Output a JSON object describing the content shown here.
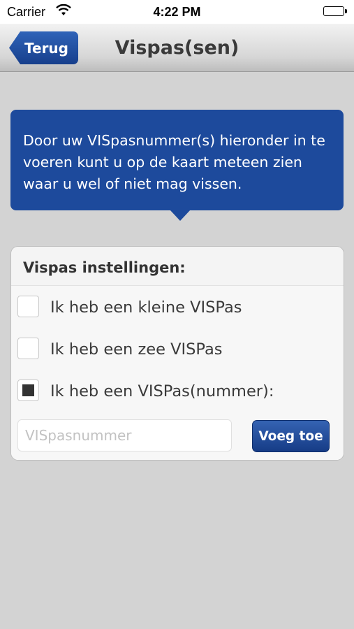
{
  "status_bar": {
    "carrier": "Carrier",
    "time": "4:22 PM",
    "icons": [
      "wifi-icon",
      "battery-icon"
    ]
  },
  "nav": {
    "back_label": "Terug",
    "title": "Vispas(sen)"
  },
  "info": {
    "text": "Door uw VISpasnummer(s) hieronder in te voeren kunt u op de kaart meteen zien waar u wel of niet mag vissen."
  },
  "settings": {
    "header": "Vispas instellingen:",
    "options": [
      {
        "label": "Ik heb een kleine VISPas",
        "checked": false
      },
      {
        "label": "Ik heb een zee VISPas",
        "checked": false
      },
      {
        "label": "Ik heb een VISPas(nummer):",
        "checked": true
      }
    ],
    "input": {
      "value": "",
      "placeholder": "VISpasnummer"
    },
    "add_label": "Voeg toe"
  },
  "colors": {
    "accent": "#1d4a9c",
    "background": "#d3d3d3"
  }
}
